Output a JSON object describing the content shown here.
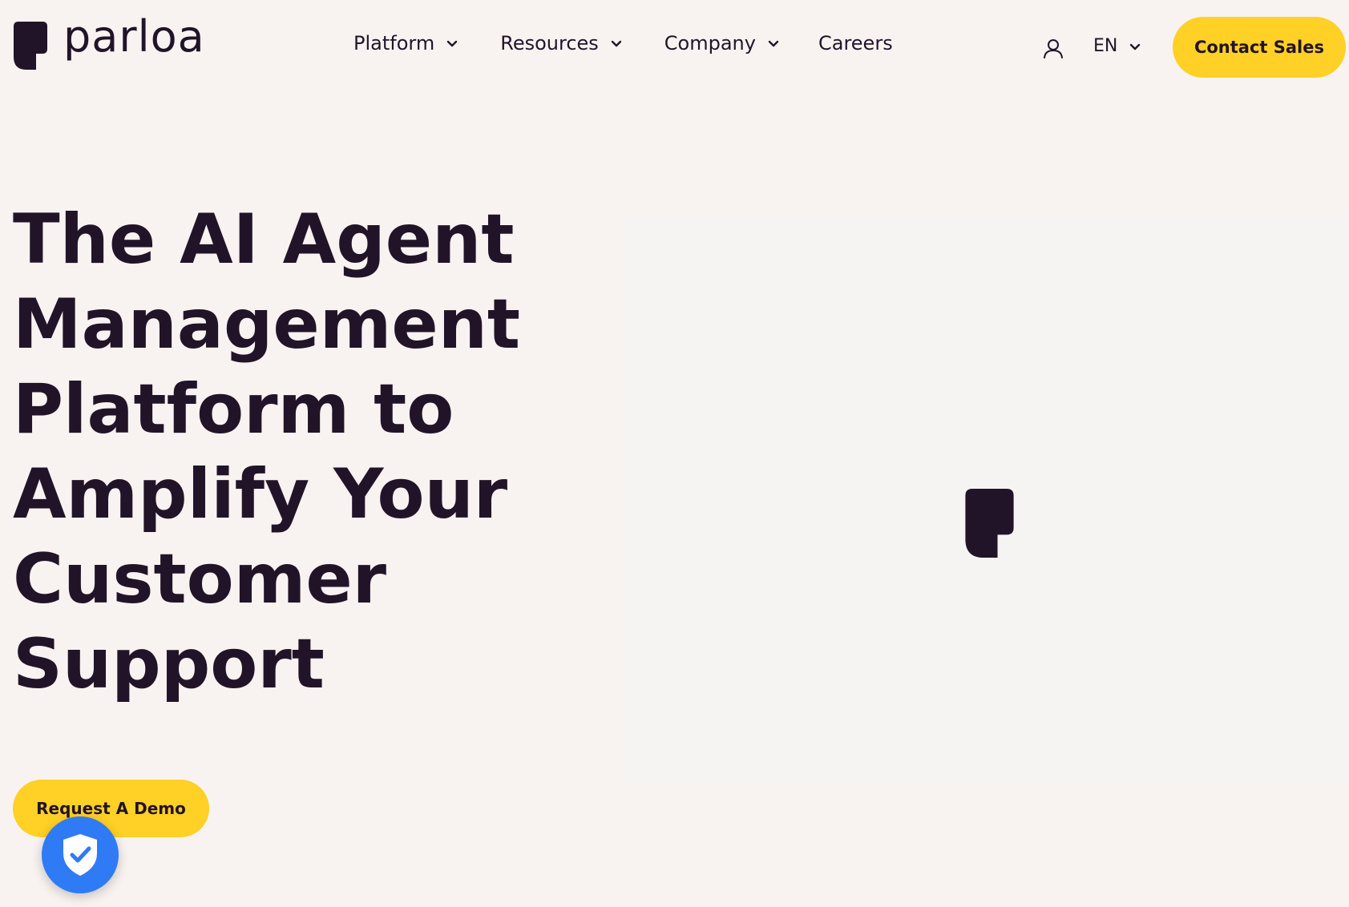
{
  "header": {
    "logo_text": "parloa",
    "logo_icon": "parloa-mark-icon",
    "nav": [
      {
        "label": "Platform",
        "has_dropdown": true
      },
      {
        "label": "Resources",
        "has_dropdown": true
      },
      {
        "label": "Company",
        "has_dropdown": true
      },
      {
        "label": "Careers",
        "has_dropdown": false
      }
    ],
    "user_icon": "user-icon",
    "language": "EN",
    "contact_label": "Contact Sales"
  },
  "hero": {
    "headline": "The AI Agent Management Platform to Amplify Your Customer Support",
    "demo_label": "Request A Demo",
    "center_icon": "parloa-mark-icon"
  },
  "badge": {
    "icon": "shield-check-icon"
  },
  "colors": {
    "background": "#F8F3F1",
    "text": "#221428",
    "accent": "#FFD025",
    "badge": "#2F7BF5"
  }
}
